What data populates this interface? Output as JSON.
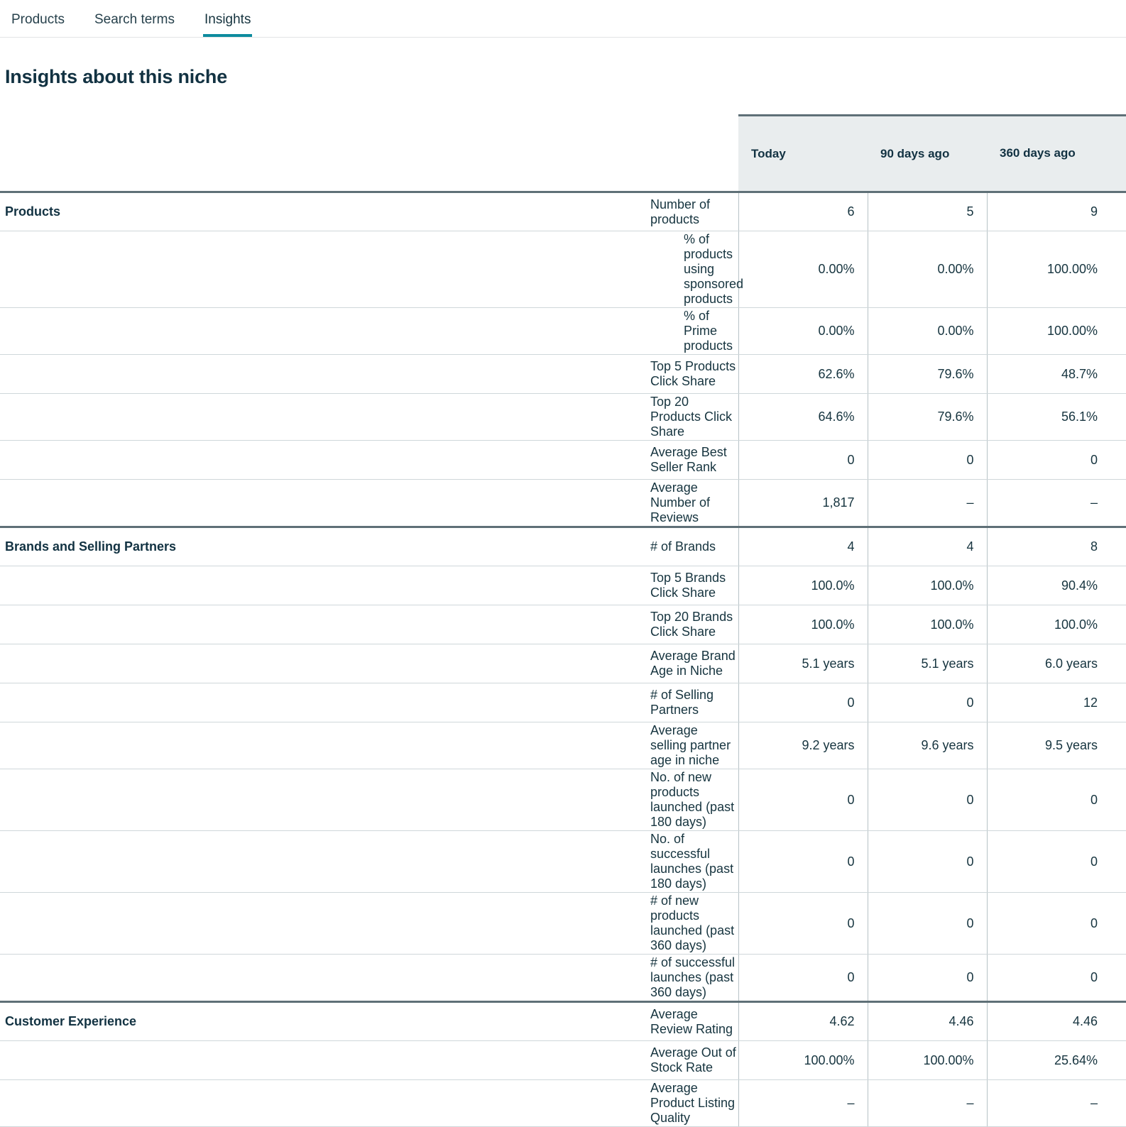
{
  "tabs": [
    {
      "label": "Products",
      "active": false
    },
    {
      "label": "Search terms",
      "active": false
    },
    {
      "label": "Insights",
      "active": true
    }
  ],
  "page": {
    "title": "Insights about this niche"
  },
  "colors": {
    "accent_teal": "#0d8b9e",
    "text_dark": "#16343f",
    "header_bg": "#e9edee",
    "section_rule": "#5f7077",
    "row_rule": "#cfd7da",
    "col_rule": "#b7c2c6"
  },
  "table": {
    "column_headers": {
      "section": "",
      "metric": "",
      "values": [
        "Today",
        "90 days ago",
        "360 days ago"
      ]
    },
    "sections": [
      {
        "name": "Products",
        "rows": [
          {
            "metric": "Number of products",
            "indent": false,
            "values": [
              "6",
              "5",
              "9"
            ]
          },
          {
            "metric": "% of products using sponsored products",
            "indent": true,
            "values": [
              "0.00%",
              "0.00%",
              "100.00%"
            ]
          },
          {
            "metric": "% of Prime products",
            "indent": true,
            "values": [
              "0.00%",
              "0.00%",
              "100.00%"
            ]
          },
          {
            "metric": "Top 5 Products Click Share",
            "indent": false,
            "values": [
              "62.6%",
              "79.6%",
              "48.7%"
            ]
          },
          {
            "metric": "Top 20 Products Click Share",
            "indent": false,
            "values": [
              "64.6%",
              "79.6%",
              "56.1%"
            ]
          },
          {
            "metric": "Average Best Seller Rank",
            "indent": false,
            "values": [
              "0",
              "0",
              "0"
            ]
          },
          {
            "metric": "Average Number of Reviews",
            "indent": false,
            "values": [
              "1,817",
              "–",
              "–"
            ]
          }
        ]
      },
      {
        "name": "Brands and Selling Partners",
        "rows": [
          {
            "metric": "# of Brands",
            "indent": false,
            "values": [
              "4",
              "4",
              "8"
            ]
          },
          {
            "metric": "Top 5 Brands Click Share",
            "indent": false,
            "values": [
              "100.0%",
              "100.0%",
              "90.4%"
            ]
          },
          {
            "metric": "Top 20 Brands Click Share",
            "indent": false,
            "values": [
              "100.0%",
              "100.0%",
              "100.0%"
            ]
          },
          {
            "metric": "Average Brand Age in Niche",
            "indent": false,
            "values": [
              "5.1 years",
              "5.1 years",
              "6.0 years"
            ]
          },
          {
            "metric": "# of Selling Partners",
            "indent": false,
            "values": [
              "0",
              "0",
              "12"
            ]
          },
          {
            "metric": "Average selling partner age in niche",
            "indent": false,
            "values": [
              "9.2 years",
              "9.6 years",
              "9.5 years"
            ]
          },
          {
            "metric": "No. of new products launched (past 180 days)",
            "indent": false,
            "values": [
              "0",
              "0",
              "0"
            ]
          },
          {
            "metric": "No. of successful launches (past 180 days)",
            "indent": false,
            "values": [
              "0",
              "0",
              "0"
            ]
          },
          {
            "metric": "# of new products launched (past 360 days)",
            "indent": false,
            "values": [
              "0",
              "0",
              "0"
            ]
          },
          {
            "metric": "# of successful launches (past 360 days)",
            "indent": false,
            "values": [
              "0",
              "0",
              "0"
            ]
          }
        ]
      },
      {
        "name": "Customer Experience",
        "rows": [
          {
            "metric": "Average Review Rating",
            "indent": false,
            "values": [
              "4.62",
              "4.46",
              "4.46"
            ]
          },
          {
            "metric": "Average Out of Stock Rate",
            "indent": false,
            "values": [
              "100.00%",
              "100.00%",
              "25.64%"
            ]
          },
          {
            "metric": "Average Product Listing Quality",
            "indent": false,
            "values": [
              "–",
              "–",
              "–"
            ]
          }
        ]
      }
    ]
  }
}
